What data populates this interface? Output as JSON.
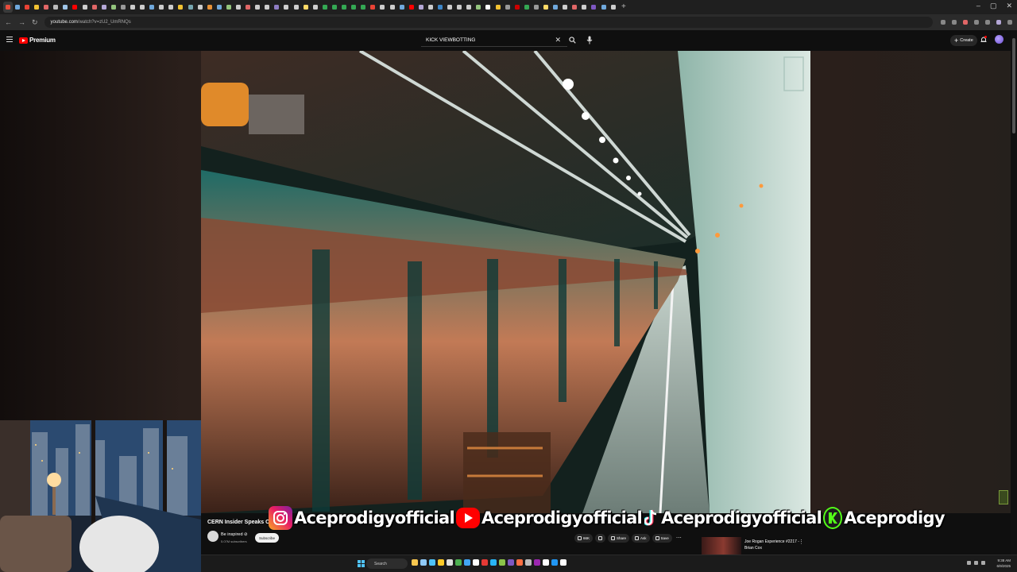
{
  "browser": {
    "tab_colors": [
      "#e74c3c",
      "#6fa8dc",
      "#ea4335",
      "#f1c232",
      "#e06666",
      "#bbbbbb",
      "#9fc5e8",
      "#ff0000",
      "#cccccc",
      "#e06666",
      "#b4a7d6",
      "#93c47d",
      "#999999",
      "#cccccc",
      "#cccccc",
      "#6fa8dc",
      "#cccccc",
      "#cccccc",
      "#f1c232",
      "#76a5af",
      "#cccccc",
      "#e69138",
      "#6fa8dc",
      "#93c47d",
      "#cccccc",
      "#e06666",
      "#cccccc",
      "#cccccc",
      "#8e7cc3",
      "#cccccc",
      "#cccccc",
      "#ffd966",
      "#cccccc",
      "#34a853",
      "#34a853",
      "#34a853",
      "#34a853",
      "#34a853",
      "#ea4335",
      "#cccccc",
      "#cccccc",
      "#6fa8dc",
      "#ff0000",
      "#b4a7d6",
      "#cccccc",
      "#3d85c6",
      "#cccccc",
      "#cccccc",
      "#cccccc",
      "#93c47d",
      "#ffffff",
      "#f1c232",
      "#999999",
      "#cc0000",
      "#34a853",
      "#999999",
      "#ffd966",
      "#6fa8dc",
      "#cccccc",
      "#e06666",
      "#cccccc",
      "#7e57c2",
      "#6fa8dc",
      "#cccccc"
    ],
    "active_tab_index": 0,
    "new_tab_label": "+",
    "window_controls": [
      "–",
      "▢",
      "✕"
    ],
    "url_host": "youtube.com",
    "url_path": "/watch?v=zU2_UmRNQs"
  },
  "youtube": {
    "logo_text": "Premium",
    "search_value": "KICK VIEWBOTTING",
    "create_label": "Create"
  },
  "video": {
    "title": "CERN Insider Speaks Out...",
    "channel_name": "Be inspired ⊘",
    "subscribers": "5.07M subscribers",
    "subscribe_label": "Subscribe",
    "like_count": "66K",
    "share_label": "Share",
    "ask_label": "Ask",
    "save_label": "Save",
    "more_label": "⋯"
  },
  "recommended": {
    "title": "Joe Rogan Experience #2217 - Brian Cox",
    "more_label": "⋮"
  },
  "stream_overlay": {
    "instagram": "Aceprodigyofficial",
    "youtube": "Aceprodigyofficial",
    "tiktok": "Aceprodigyofficial",
    "kick": "Aceprodigy"
  },
  "taskbar": {
    "search_label": "Search",
    "time": "9:38 AM",
    "date": "6/9/2025",
    "app_colors": [
      "#f9c74f",
      "#90caf9",
      "#4fc3f7",
      "#ffca28",
      "#e0e0e0",
      "#4caf50",
      "#42a5f5",
      "#ffffff",
      "#e53935",
      "#29b6f6",
      "#8bc34a",
      "#7e57c2",
      "#ff7043",
      "#bdbdbd",
      "#9c27b0",
      "#ffffff",
      "#2196f3",
      "#ffffff"
    ]
  }
}
